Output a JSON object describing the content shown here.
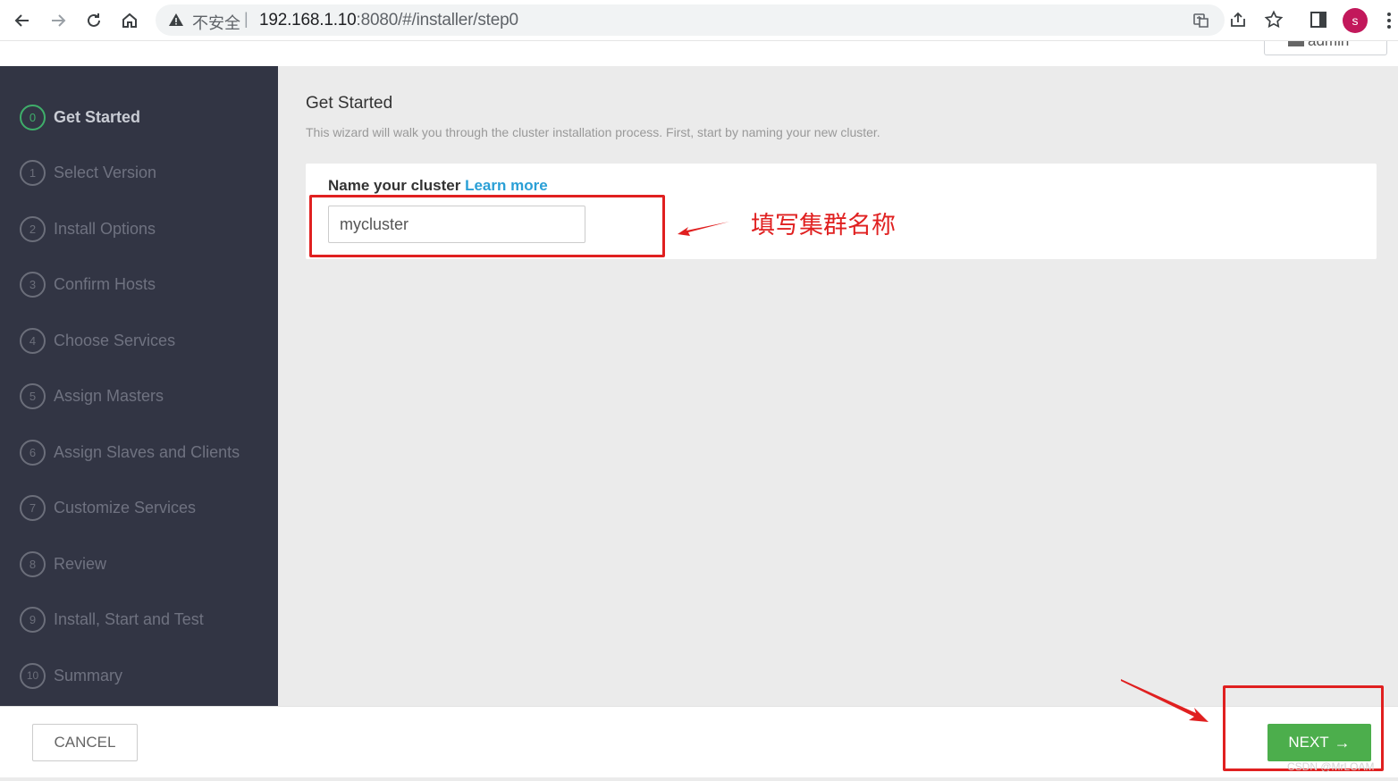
{
  "browser": {
    "insecure_label": "不安全",
    "separator": "|",
    "url_host": "192.168.1.10",
    "url_path": ":8080/#/installer/step0",
    "avatar_letter": "s",
    "icons": [
      "back-icon",
      "forward-icon",
      "reload-icon",
      "home-icon",
      "warning-icon",
      "translate-icon",
      "share-icon",
      "star-icon",
      "sidepanel-icon",
      "menu-icon"
    ]
  },
  "header": {
    "user_label": "admin"
  },
  "sidebar": {
    "steps": [
      {
        "num": "0",
        "label": "Get Started",
        "active": true
      },
      {
        "num": "1",
        "label": "Select Version",
        "active": false
      },
      {
        "num": "2",
        "label": "Install Options",
        "active": false
      },
      {
        "num": "3",
        "label": "Confirm Hosts",
        "active": false
      },
      {
        "num": "4",
        "label": "Choose Services",
        "active": false
      },
      {
        "num": "5",
        "label": "Assign Masters",
        "active": false
      },
      {
        "num": "6",
        "label": "Assign Slaves and Clients",
        "active": false
      },
      {
        "num": "7",
        "label": "Customize Services",
        "active": false
      },
      {
        "num": "8",
        "label": "Review",
        "active": false
      },
      {
        "num": "9",
        "label": "Install, Start and Test",
        "active": false
      },
      {
        "num": "10",
        "label": "Summary",
        "active": false
      }
    ]
  },
  "main": {
    "title": "Get Started",
    "description": "This wizard will walk you through the cluster installation process. First, start by naming your new cluster.",
    "cluster_label": "Name your cluster",
    "learn_more": "Learn more",
    "cluster_value": "mycluster"
  },
  "annotation": {
    "text": "填写集群名称",
    "color": "#e02020"
  },
  "footer": {
    "cancel_label": "CANCEL",
    "next_label": "NEXT",
    "next_arrow": "→",
    "next_color": "#4cae4c"
  },
  "watermark": "CSDN @MrLOAM"
}
